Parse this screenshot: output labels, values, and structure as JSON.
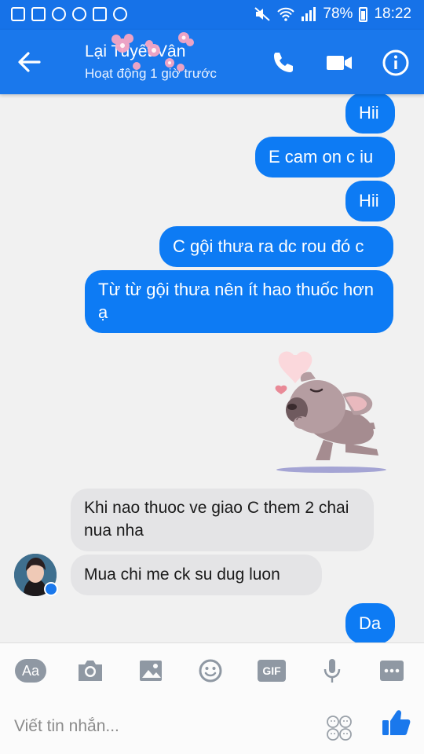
{
  "status_bar": {
    "battery": "78%",
    "time": "18:22"
  },
  "header": {
    "title": "Lại Tuyết Vân",
    "subtitle": "Hoạt động 1 giờ trước"
  },
  "messages": [
    {
      "type": "out",
      "text": "Hii"
    },
    {
      "type": "out",
      "text": "E cam on c iu"
    },
    {
      "type": "out",
      "text": "Hii"
    },
    {
      "type": "out",
      "text": "C gội thưa ra dc rou đó c"
    },
    {
      "type": "out",
      "text": "Từ từ gội thưa nên ít hao thuốc hơn ạ"
    },
    {
      "type": "sticker",
      "name": "dog-blowing-heart-sticker"
    },
    {
      "type": "in",
      "text": "Khi nao thuoc ve giao C them 2 chai nua nha"
    },
    {
      "type": "in",
      "text": "Mua chi me ck su dug luon"
    },
    {
      "type": "out",
      "text": "Da"
    }
  ],
  "composer": {
    "placeholder": "Viết tin nhắn...",
    "tools": [
      "aa-icon",
      "camera-icon",
      "image-icon",
      "emoji-icon",
      "gif-icon",
      "mic-icon",
      "more-icon"
    ],
    "aa_label": "Aa",
    "gif_label": "GIF"
  },
  "colors": {
    "brand": "#1a78ec",
    "bubble_out": "#0d7bf4",
    "bubble_in": "#e4e4e6"
  }
}
